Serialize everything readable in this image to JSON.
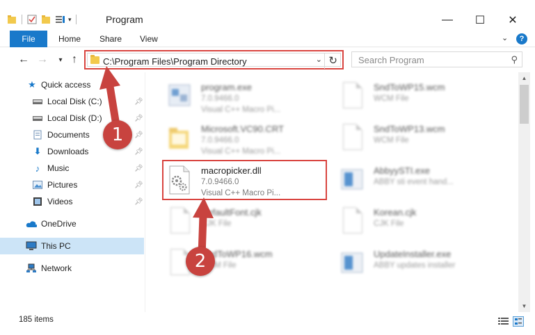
{
  "window": {
    "title": "Program",
    "minimize_glyph": "—",
    "maximize_glyph": "☐",
    "close_glyph": "✕"
  },
  "ribbon": {
    "tabs": [
      {
        "label": "File"
      },
      {
        "label": "Home"
      },
      {
        "label": "Share"
      },
      {
        "label": "View"
      }
    ],
    "help_glyph": "?"
  },
  "navigation": {
    "address": "C:\\Program Files\\Program Directory",
    "search_placeholder": "Search Program"
  },
  "sidebar": {
    "items": [
      {
        "label": "Quick access",
        "icon": "star-icon"
      },
      {
        "label": "Local Disk (C:)",
        "icon": "drive-icon",
        "pinned": true
      },
      {
        "label": "Local Disk (D:)",
        "icon": "drive-icon",
        "pinned": true
      },
      {
        "label": "Documents",
        "icon": "documents-icon",
        "pinned": true
      },
      {
        "label": "Downloads",
        "icon": "download-icon",
        "pinned": true
      },
      {
        "label": "Music",
        "icon": "music-icon",
        "pinned": true
      },
      {
        "label": "Pictures",
        "icon": "pictures-icon",
        "pinned": true
      },
      {
        "label": "Videos",
        "icon": "videos-icon",
        "pinned": true
      },
      {
        "label": "OneDrive",
        "icon": "cloud-icon"
      },
      {
        "label": "This PC",
        "icon": "computer-icon",
        "selected": true
      },
      {
        "label": "Network",
        "icon": "network-icon"
      }
    ]
  },
  "files": [
    {
      "name": "program.exe",
      "line1": "7.0.9466.0",
      "line2": "Visual C++ Macro Pi...",
      "icon": "exe-icon",
      "blurred": true
    },
    {
      "name": "SndToWP15.wcm",
      "line1": "WCM File",
      "line2": "",
      "icon": "file-icon",
      "blurred": true
    },
    {
      "name": "Microsoft.VC90.CRT",
      "line1": "7.0.9466.0",
      "line2": "Visual C++ Macro Pi...",
      "icon": "folder-icon",
      "blurred": true
    },
    {
      "name": "SndToWP13.wcm",
      "line1": "WCM File",
      "line2": "",
      "icon": "file-icon",
      "blurred": true
    },
    {
      "name": "macropicker.dll",
      "line1": "7.0.9466.0",
      "line2": "Visual C++ Macro Pi...",
      "icon": "dll-gear-icon",
      "blurred": false
    },
    {
      "name": "AbbyySTI.exe",
      "line1": "ABBY sti event hand...",
      "line2": "",
      "icon": "exe-icon",
      "blurred": true
    },
    {
      "name": "DefaultFont.cjk",
      "line1": "CJK File",
      "line2": "",
      "icon": "file-icon",
      "blurred": true
    },
    {
      "name": "Korean.cjk",
      "line1": "CJK File",
      "line2": "",
      "icon": "file-icon",
      "blurred": true
    },
    {
      "name": "SndToWP16.wcm",
      "line1": "WCM File",
      "line2": "",
      "icon": "file-icon",
      "blurred": true
    },
    {
      "name": "UpdateInstaller.exe",
      "line1": "ABBY updates installer",
      "line2": "",
      "icon": "exe-icon",
      "blurred": true
    }
  ],
  "status": {
    "item_count": "185 items"
  },
  "annotations": {
    "step1": "1",
    "step2": "2",
    "color": "#c8433f"
  }
}
